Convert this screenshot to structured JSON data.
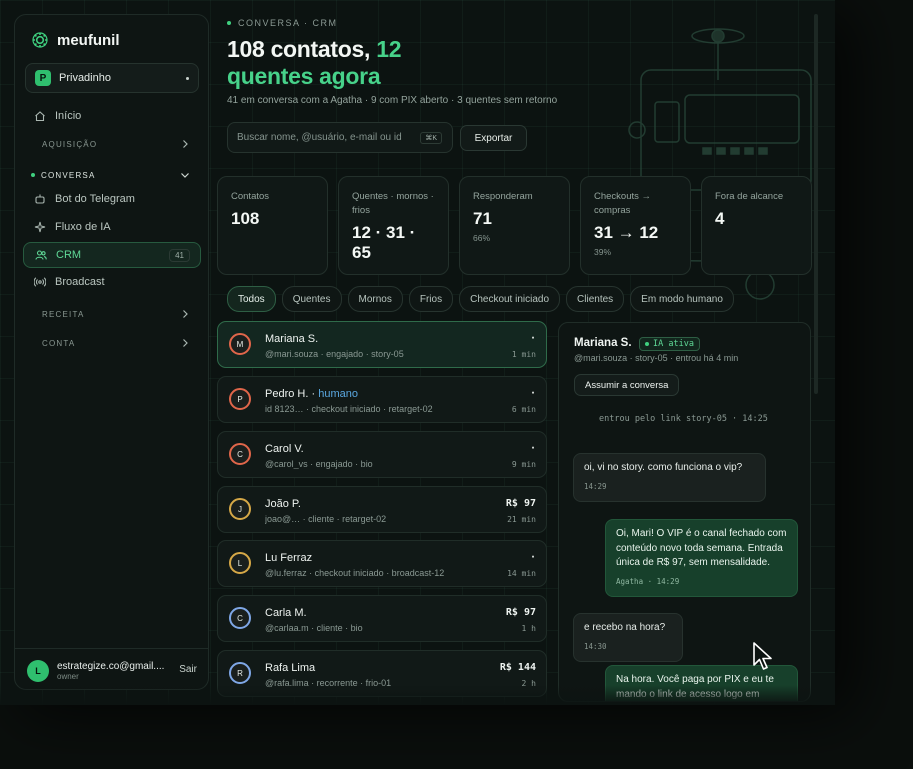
{
  "brand": {
    "name": "meufunil"
  },
  "workspace": {
    "badge": "P",
    "name": "Privadinho"
  },
  "nav": {
    "inicio": "Início",
    "aquisicao": "AQUISIÇÃO",
    "conversa": "CONVERSA",
    "bot": "Bot do Telegram",
    "fluxo": "Fluxo de IA",
    "crm": "CRM",
    "crm_count": "41",
    "broadcast": "Broadcast",
    "receita": "RECEITA",
    "conta": "CONTA"
  },
  "user": {
    "initial": "L",
    "email": "estrategize.co@gmail....",
    "role": "owner",
    "logout": "Sair"
  },
  "header": {
    "eyebrow": "CONVERSA · CRM",
    "title_main": "108 contatos,",
    "title_highlight": "12 quentes agora",
    "subtitle": "41 em conversa com a Agatha · 9 com PIX aberto · 3 quentes sem retorno"
  },
  "search": {
    "placeholder": "Buscar nome, @usuário, e-mail ou id",
    "shortcut": "⌘K"
  },
  "export_label": "Exportar",
  "stats": [
    {
      "label": "Contatos",
      "value": "108",
      "sub": ""
    },
    {
      "label": "Quentes · mornos · frios",
      "value": "12 · 31 · 65",
      "sub": ""
    },
    {
      "label": "Responderam",
      "value": "71",
      "sub": "66%"
    },
    {
      "label": "Checkouts → compras",
      "value": "31 → 12",
      "sub": "39%"
    },
    {
      "label": "Fora de alcance",
      "value": "4",
      "sub": ""
    }
  ],
  "filters": [
    "Todos",
    "Quentes",
    "Mornos",
    "Frios",
    "Checkout iniciado",
    "Clientes",
    "Em modo humano"
  ],
  "contacts": [
    {
      "initial": "M",
      "name": "Mariana S.",
      "tag": "",
      "meta": "@mari.souza · engajado · story-05",
      "value": "·",
      "time": "1 min",
      "ring": "#e0664a"
    },
    {
      "initial": "P",
      "name": "Pedro H. ·",
      "tag": "humano",
      "meta": "id 8123… · checkout iniciado · retarget-02",
      "value": "·",
      "time": "6 min",
      "ring": "#e0664a"
    },
    {
      "initial": "C",
      "name": "Carol V.",
      "tag": "",
      "meta": "@carol_vs · engajado · bio",
      "value": "·",
      "time": "9 min",
      "ring": "#e0664a"
    },
    {
      "initial": "J",
      "name": "João P.",
      "tag": "",
      "meta": "joao@… · cliente · retarget-02",
      "value": "R$ 97",
      "time": "21 min",
      "ring": "#d6a847"
    },
    {
      "initial": "L",
      "name": "Lu Ferraz",
      "tag": "",
      "meta": "@lu.ferraz · checkout iniciado · broadcast-12",
      "value": "·",
      "time": "14 min",
      "ring": "#d6a847"
    },
    {
      "initial": "C",
      "name": "Carla M.",
      "tag": "",
      "meta": "@carlaa.m · cliente · bio",
      "value": "R$ 97",
      "time": "1 h",
      "ring": "#7fa7e6"
    },
    {
      "initial": "R",
      "name": "Rafa Lima",
      "tag": "",
      "meta": "@rafa.lima · recorrente · frio-01",
      "value": "R$ 144",
      "time": "2 h",
      "ring": "#7fa7e6"
    }
  ],
  "chat": {
    "name": "Mariana S.",
    "badge": "IA ativa",
    "meta": "@mari.souza · story-05 · entrou há 4 min",
    "assume_label": "Assumir a conversa",
    "system": "entrou pelo link story-05 · 14:25",
    "messages": [
      {
        "text": "oi, vi no story. como funciona o vip?",
        "time": "14:29"
      },
      {
        "text": "Oi, Mari! O VIP é o canal fechado com conteúdo novo toda semana. Entrada única de R$ 97, sem mensalidade.",
        "time": "Agatha · 14:29"
      },
      {
        "text": "e recebo na hora?",
        "time": "14:30"
      },
      {
        "text": "Na hora. Você paga por PIX e eu te mando o link de acesso logo em seguida.",
        "time": ""
      }
    ]
  },
  "colors": {
    "accent": "#47d28a",
    "background": "#0c1311",
    "human_tag": "#5aa7e0"
  }
}
